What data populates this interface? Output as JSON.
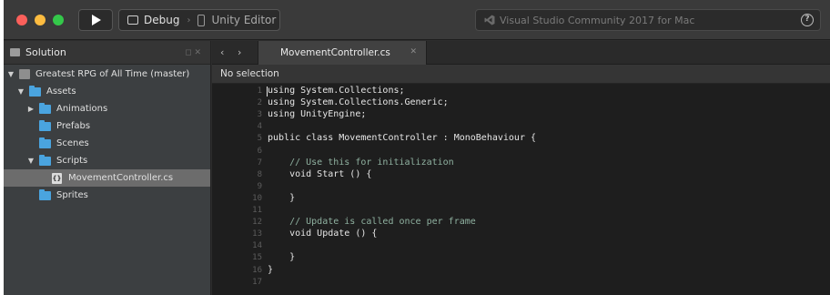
{
  "titlebar": {
    "configuration": "Debug",
    "device": "Unity Editor",
    "status": "Visual Studio Community 2017 for Mac"
  },
  "solution_pad": {
    "title": "Solution",
    "tree": [
      {
        "label": "Greatest RPG of All Time (master)",
        "kind": "solution",
        "expanded": true,
        "depth": 0
      },
      {
        "label": "Assets",
        "kind": "folder",
        "expanded": true,
        "depth": 1
      },
      {
        "label": "Animations",
        "kind": "folder",
        "expanded": false,
        "depth": 2
      },
      {
        "label": "Prefabs",
        "kind": "folder",
        "expanded": null,
        "depth": 2
      },
      {
        "label": "Scenes",
        "kind": "folder",
        "expanded": null,
        "depth": 2
      },
      {
        "label": "Scripts",
        "kind": "folder",
        "expanded": true,
        "depth": 2
      },
      {
        "label": "MovementController.cs",
        "kind": "file",
        "selected": true,
        "depth": 3
      },
      {
        "label": "Sprites",
        "kind": "folder",
        "expanded": null,
        "depth": 2
      }
    ]
  },
  "editor": {
    "tab_label": "MovementController.cs",
    "breadcrumb": "No selection",
    "lines": [
      {
        "n": "1",
        "text": "using System.Collections;"
      },
      {
        "n": "2",
        "text": "using System.Collections.Generic;"
      },
      {
        "n": "3",
        "text": "using UnityEngine;"
      },
      {
        "n": "4",
        "text": ""
      },
      {
        "n": "5",
        "text": "public class MovementController : MonoBehaviour {"
      },
      {
        "n": "6",
        "text": ""
      },
      {
        "n": "7",
        "text": "    // Use this for initialization",
        "comment": true
      },
      {
        "n": "8",
        "text": "    void Start () {"
      },
      {
        "n": "9",
        "text": ""
      },
      {
        "n": "10",
        "text": "    }"
      },
      {
        "n": "11",
        "text": ""
      },
      {
        "n": "12",
        "text": "    // Update is called once per frame",
        "comment": true
      },
      {
        "n": "13",
        "text": "    void Update () {"
      },
      {
        "n": "14",
        "text": ""
      },
      {
        "n": "15",
        "text": "    }"
      },
      {
        "n": "16",
        "text": "}"
      },
      {
        "n": "17",
        "text": ""
      }
    ]
  }
}
